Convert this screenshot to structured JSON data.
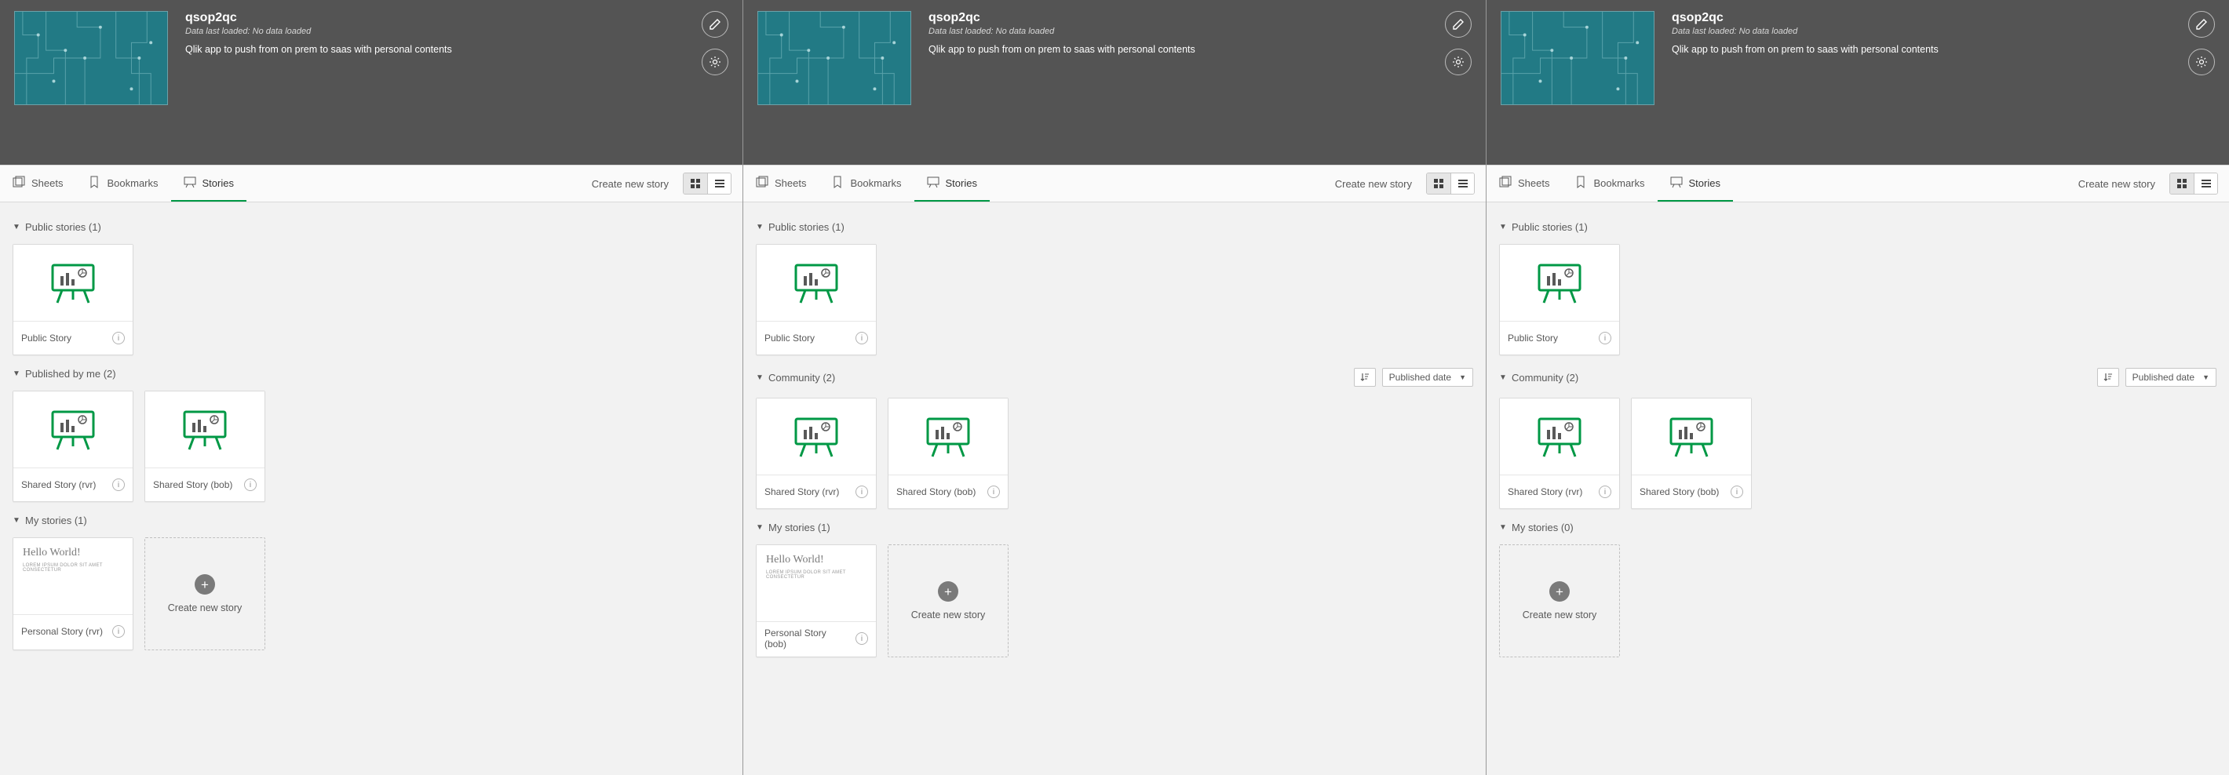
{
  "header": {
    "app_title": "qsop2qc",
    "subtitle_prefix": "Data last loaded:",
    "subtitle_value": "No data loaded",
    "description": "Qlik app to push from on prem to saas with personal contents"
  },
  "toolbar": {
    "tabs": {
      "sheets": "Sheets",
      "bookmarks": "Bookmarks",
      "stories": "Stories"
    },
    "create_new_story": "Create new story"
  },
  "common": {
    "create_card_label": "Create new story",
    "sort_label": "Published date"
  },
  "panels": [
    {
      "sections": [
        {
          "title": "Public stories (1)",
          "has_sort": false,
          "cards": [
            {
              "title": "Public Story",
              "thumb": "easel"
            }
          ]
        },
        {
          "title": "Published by me (2)",
          "has_sort": false,
          "cards": [
            {
              "title": "Shared Story (rvr)",
              "thumb": "easel"
            },
            {
              "title": "Shared Story (bob)",
              "thumb": "easel"
            }
          ]
        },
        {
          "title": "My stories (1)",
          "has_sort": false,
          "cards": [
            {
              "title": "Personal Story (rvr)",
              "thumb": "personal"
            }
          ],
          "show_create": true
        }
      ]
    },
    {
      "sections": [
        {
          "title": "Public stories (1)",
          "has_sort": false,
          "cards": [
            {
              "title": "Public Story",
              "thumb": "easel"
            }
          ]
        },
        {
          "title": "Community (2)",
          "has_sort": true,
          "cards": [
            {
              "title": "Shared Story (rvr)",
              "thumb": "easel"
            },
            {
              "title": "Shared Story (bob)",
              "thumb": "easel"
            }
          ]
        },
        {
          "title": "My stories (1)",
          "has_sort": false,
          "cards": [
            {
              "title": "Personal Story (bob)",
              "thumb": "personal"
            }
          ],
          "show_create": true
        }
      ]
    },
    {
      "sections": [
        {
          "title": "Public stories (1)",
          "has_sort": false,
          "cards": [
            {
              "title": "Public Story",
              "thumb": "easel"
            }
          ]
        },
        {
          "title": "Community (2)",
          "has_sort": true,
          "cards": [
            {
              "title": "Shared Story (rvr)",
              "thumb": "easel"
            },
            {
              "title": "Shared Story (bob)",
              "thumb": "easel"
            }
          ]
        },
        {
          "title": "My stories (0)",
          "has_sort": false,
          "cards": [],
          "show_create": true
        }
      ]
    }
  ]
}
